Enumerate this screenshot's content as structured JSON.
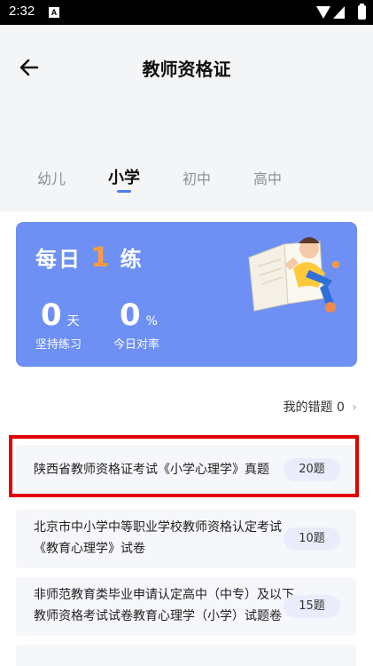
{
  "status_bar": {
    "time": "2:32",
    "notification_icon": "A"
  },
  "header": {
    "title": "教师资格证",
    "back_icon": "arrow-left-icon"
  },
  "tabs": [
    {
      "label": "幼儿",
      "active": false
    },
    {
      "label": "小学",
      "active": true
    },
    {
      "label": "初中",
      "active": false
    },
    {
      "label": "高中",
      "active": false
    }
  ],
  "daily": {
    "title_pre": "每日",
    "title_num": "1",
    "title_post": "练",
    "days_value": "0",
    "days_unit": "天",
    "days_label": "坚持练习",
    "rate_value": "0",
    "rate_unit": "%",
    "rate_label": "今日对率"
  },
  "wrong_questions": {
    "label": "我的错题",
    "count": "0",
    "chevron": "›"
  },
  "exam_list": [
    {
      "title": "陕西省教师资格证考试《小学心理学》真题",
      "count": "20题",
      "highlighted": true
    },
    {
      "title": "北京市中小学中等职业学校教师资格认定考试《教育心理学》试卷",
      "count": "10题",
      "highlighted": false
    },
    {
      "title": "非师范教育类毕业申请认定高中（中专）及以下教师资格考试试卷教育心理学（小学）试题卷",
      "count": "15题",
      "highlighted": false
    }
  ],
  "colors": {
    "card_bg": "#6e90f4",
    "accent": "#4b7cf5",
    "highlight": "#e10000",
    "badge_bg": "#e9edfb"
  }
}
